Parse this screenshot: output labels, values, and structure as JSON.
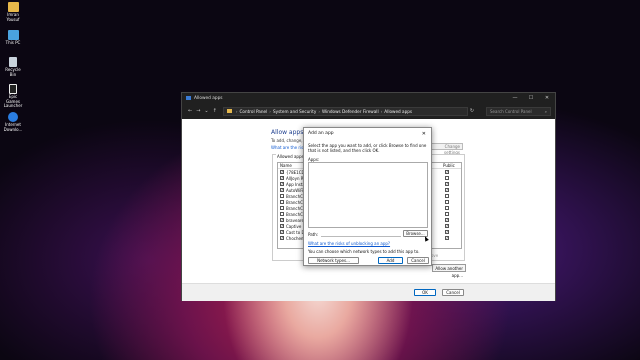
{
  "desktop": {
    "icons": [
      {
        "label": "Imran Yousuf",
        "icon": "folder-icon",
        "color": "#e8b84a"
      },
      {
        "label": "This PC",
        "icon": "monitor-icon",
        "color": "#4aa3df"
      },
      {
        "label": "Recycle Bin",
        "icon": "recycle-bin-icon",
        "color": "#c9d3dc"
      },
      {
        "label": "Epic Games Launcher",
        "icon": "epic-games-icon",
        "color": "#222222"
      },
      {
        "label": "Internet Downlo...",
        "icon": "idm-icon",
        "color": "#2a7de1"
      }
    ]
  },
  "window": {
    "title": "Allowed apps",
    "controls": [
      "—",
      "☐",
      "✕"
    ],
    "address": [
      "Control Panel",
      "System and Security",
      "Windows Defender Firewall",
      "Allowed apps"
    ],
    "search_placeholder": "Search Control Panel",
    "heading": "Allow apps to",
    "description": "To add, change, or",
    "risks_link": "What are the risks",
    "change_settings": "Change settings",
    "group_label": "Allowed apps an",
    "columns": {
      "name": "Name",
      "private": "",
      "public": "Public"
    },
    "rows": [
      {
        "name": "{78E1CD88-4",
        "checked": true,
        "public": true
      },
      {
        "name": "AllJoyn Rout",
        "checked": true,
        "public": false
      },
      {
        "name": "App Installe",
        "checked": true,
        "public": true
      },
      {
        "name": "AutoWiFin",
        "checked": true,
        "public": true
      },
      {
        "name": "BranchCach",
        "checked": false,
        "public": false
      },
      {
        "name": "BranchCach",
        "checked": false,
        "public": false
      },
      {
        "name": "BranchCach",
        "checked": false,
        "public": false
      },
      {
        "name": "BranchCach",
        "checked": false,
        "public": false
      },
      {
        "name": "bravearee",
        "checked": true,
        "public": true
      },
      {
        "name": "Captive Port",
        "checked": true,
        "public": true
      },
      {
        "name": "Cast to Dev",
        "checked": true,
        "public": true
      },
      {
        "name": "Chocheme",
        "checked": true,
        "public": true
      }
    ],
    "remove": "Remove",
    "allow_another": "Allow another app...",
    "ok": "OK",
    "cancel": "Cancel"
  },
  "dialog": {
    "title": "Add an app",
    "close": "✕",
    "instructions": "Select the app you want to add, or click Browse to find one that is not listed, and then click OK.",
    "apps_label": "Apps:",
    "path_label": "Path:",
    "browse": "Browse...",
    "risks_link": "What are the risks of unblocking an app?",
    "network_note": "You can choose which network types to add this app to.",
    "network_types": "Network types...",
    "add": "Add",
    "cancel": "Cancel"
  }
}
